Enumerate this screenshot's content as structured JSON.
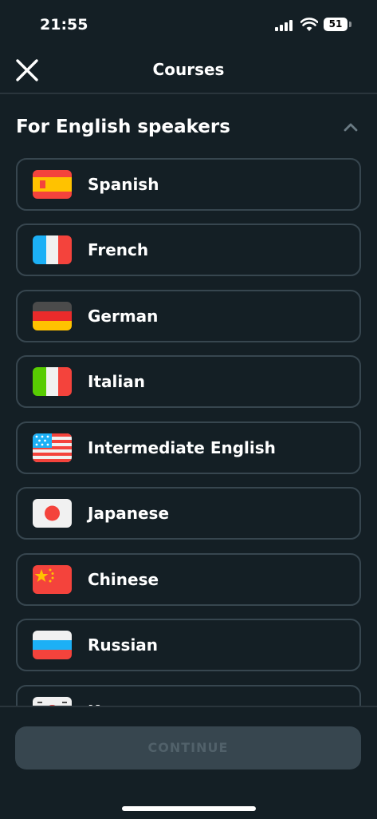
{
  "status_bar": {
    "time": "21:55",
    "battery": "51"
  },
  "header": {
    "title": "Courses",
    "close_icon": "close-icon"
  },
  "section": {
    "title": "For English speakers",
    "toggle_icon": "chevron-up-icon"
  },
  "courses": [
    {
      "label": "Spanish",
      "flag": "spain-flag-icon"
    },
    {
      "label": "French",
      "flag": "france-flag-icon"
    },
    {
      "label": "German",
      "flag": "germany-flag-icon"
    },
    {
      "label": "Italian",
      "flag": "italy-flag-icon"
    },
    {
      "label": "Intermediate English",
      "flag": "usa-flag-icon"
    },
    {
      "label": "Japanese",
      "flag": "japan-flag-icon"
    },
    {
      "label": "Chinese",
      "flag": "china-flag-icon"
    },
    {
      "label": "Russian",
      "flag": "russia-flag-icon"
    },
    {
      "label": "Korean",
      "flag": "korea-flag-icon"
    }
  ],
  "footer": {
    "continue_label": "CONTINUE"
  },
  "colors": {
    "background": "#141f25",
    "border": "#37464f",
    "button_disabled": "#37464f",
    "button_text_disabled": "#51616a"
  }
}
